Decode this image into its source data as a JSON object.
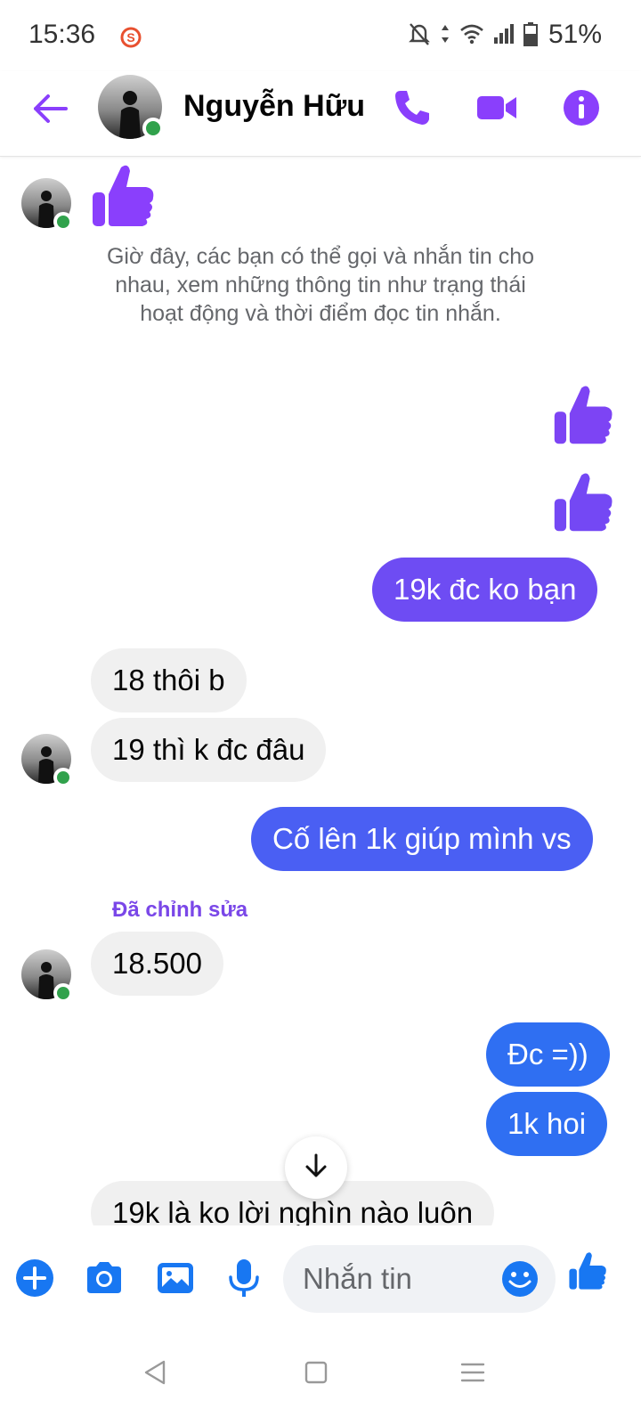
{
  "status_bar": {
    "time": "15:36",
    "battery": "51%"
  },
  "header": {
    "contact_name": "Nguyễn Hữu"
  },
  "chat": {
    "info_text": "Giờ đây, các bạn có thể gọi và nhắn tin cho nhau, xem những thông tin như trạng thái hoạt động và thời điểm đọc tin nhắn.",
    "messages": {
      "out_1": "19k đc ko bạn",
      "in_1": "18 thôi b",
      "in_2": "19 thì k đc đâu",
      "out_2": "Cố lên 1k giúp mình vs",
      "edited_label": "Đã chỉnh sửa",
      "in_3": "18.500",
      "out_3": "Đc =))",
      "out_4": "1k hoi",
      "in_4": "19k là ko lời nghìn nào luôn"
    }
  },
  "composer": {
    "placeholder": "Nhắn tin"
  },
  "colors": {
    "accent_purple": "#8a3ffc",
    "outgoing_purple": "#6e4cf3",
    "outgoing_blue": "#2f6ff2",
    "composer_blue": "#1877f2",
    "online_green": "#31a24c",
    "incoming_bg": "#f0f0f0"
  },
  "icons": {
    "header": [
      "back-arrow-icon",
      "phone-icon",
      "video-camera-icon",
      "info-icon"
    ],
    "composer": [
      "plus-icon",
      "camera-icon",
      "image-icon",
      "microphone-icon",
      "emoji-icon",
      "thumbs-up-icon"
    ],
    "nav": [
      "back-triangle-icon",
      "home-square-icon",
      "menu-lines-icon"
    ]
  }
}
